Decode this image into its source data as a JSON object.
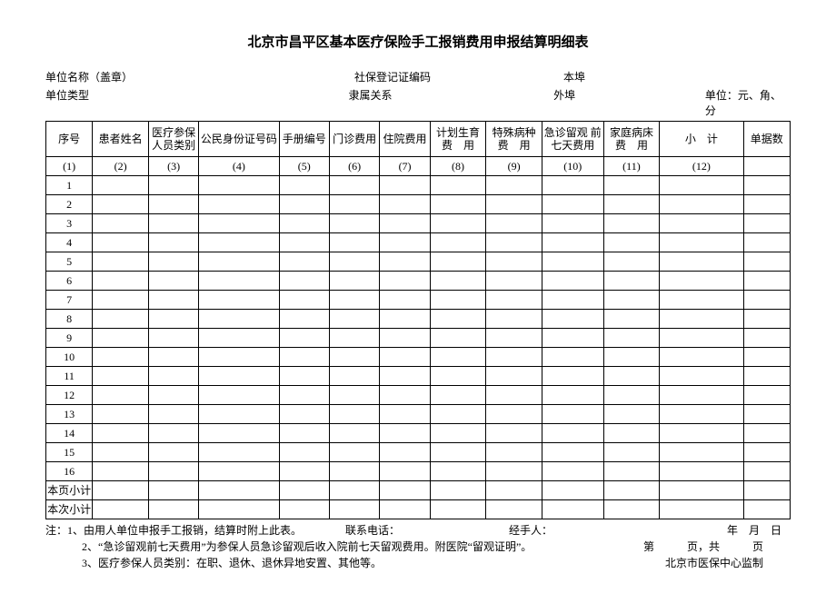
{
  "title": "北京市昌平区基本医疗保险手工报销费用申报结算明细表",
  "info": {
    "unit_name_label": "单位名称（盖章）",
    "social_code_label": "社保登记证编码",
    "local_label": "本埠",
    "unit_type_label": "单位类型",
    "relation_label": "隶属关系",
    "remote_label": "外埠",
    "unit_hint": "单位：元、角、分"
  },
  "headers": {
    "seq": "序号",
    "name": "患者姓名",
    "cat": "医疗参保\n人员类别",
    "id": "公民身份证号码",
    "book": "手册编号",
    "out": "门诊费用",
    "in": "住院费用",
    "plan": "计划生育\n费　用",
    "spec": "特殊病种\n费　用",
    "emerg": "急诊留观\n前七天费用",
    "home": "家庭病床\n费　用",
    "sub": "小　计",
    "cnt": "单据数"
  },
  "colnums": [
    "(1)",
    "(2)",
    "(3)",
    "(4)",
    "(5)",
    "(6)",
    "(7)",
    "(8)",
    "(9)",
    "(10)",
    "(11)",
    "(12)"
  ],
  "rows": [
    "1",
    "2",
    "3",
    "4",
    "5",
    "6",
    "7",
    "8",
    "9",
    "10",
    "11",
    "12",
    "13",
    "14",
    "15",
    "16"
  ],
  "footer_rows": {
    "page_subtotal": "本页小计",
    "this_subtotal": "本次小计"
  },
  "notes": {
    "prefix": "注：",
    "n1": "1、由用人单位申报手工报销，结算时附上此表。",
    "contact_label": "联系电话：",
    "handler_label": "经手人：",
    "date_label": "年　月　日",
    "n2": "2、“急诊留观前七天费用”为参保人员急诊留观后收入院前七天留观费用。附医院“留观证明”。",
    "page_label": "第　　　页，共　　　页",
    "n3": "3、医疗参保人员类别：在职、退休、退休异地安置、其他等。",
    "issuer": "北京市医保中心监制"
  }
}
